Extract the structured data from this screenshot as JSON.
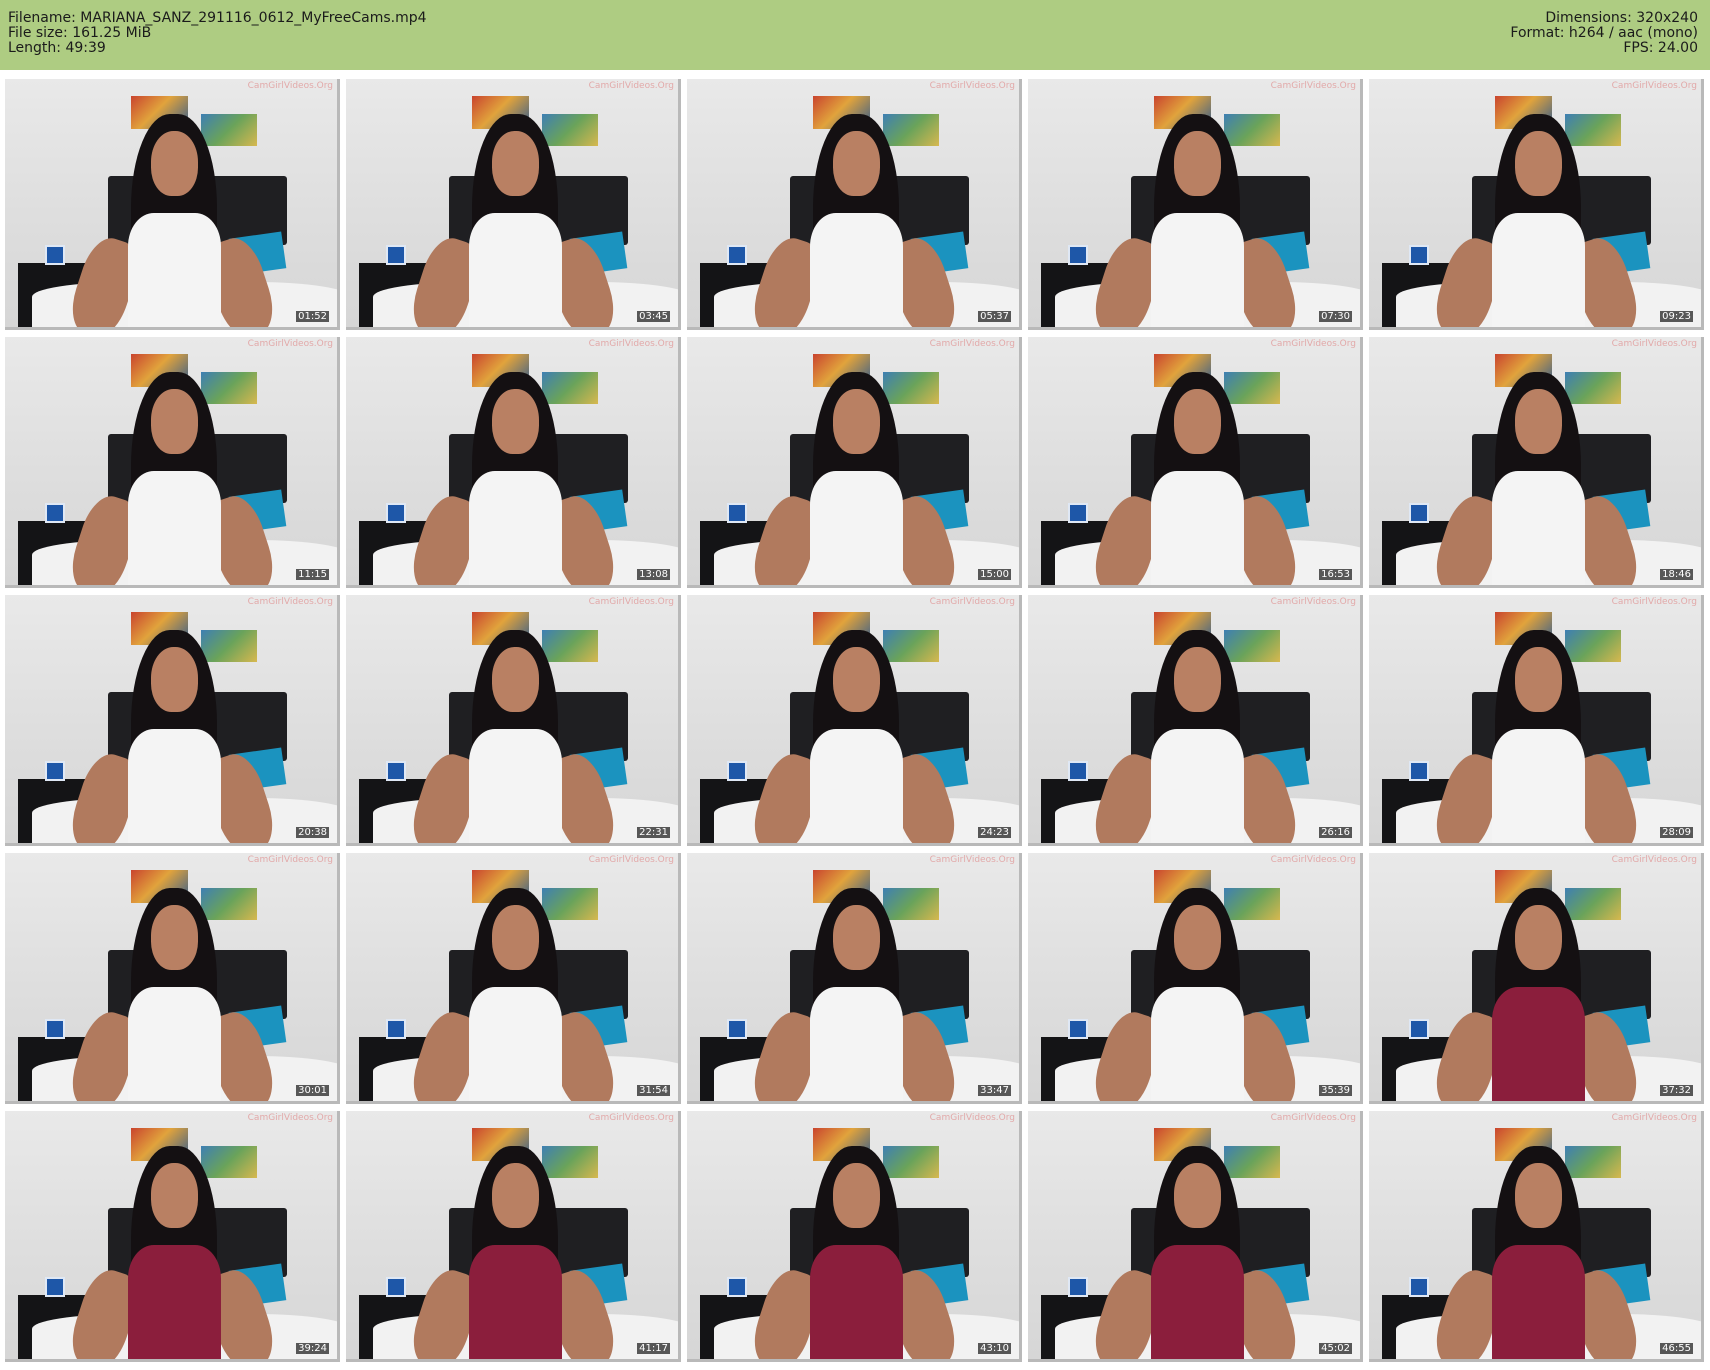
{
  "header": {
    "left": [
      "Filename: MARIANA_SANZ_291116_0612_MyFreeCams.mp4",
      "File size: 161.25 MiB",
      "Length: 49:39"
    ],
    "right": [
      "Dimensions: 320x240",
      "Format: h264 / aac (mono)",
      "FPS: 24.00"
    ]
  },
  "watermark": "CamGirlVideos.Org",
  "colors": {
    "header_bg": "#aecc82",
    "bra": "#8b1e3c",
    "pillow": "#1b93bf"
  },
  "thumbnails": [
    {
      "time": "01:52",
      "top": "white"
    },
    {
      "time": "03:45",
      "top": "white"
    },
    {
      "time": "05:37",
      "top": "white"
    },
    {
      "time": "07:30",
      "top": "white"
    },
    {
      "time": "09:23",
      "top": "white"
    },
    {
      "time": "11:15",
      "top": "white"
    },
    {
      "time": "13:08",
      "top": "white"
    },
    {
      "time": "15:00",
      "top": "white"
    },
    {
      "time": "16:53",
      "top": "white"
    },
    {
      "time": "18:46",
      "top": "white"
    },
    {
      "time": "20:38",
      "top": "white"
    },
    {
      "time": "22:31",
      "top": "white"
    },
    {
      "time": "24:23",
      "top": "white"
    },
    {
      "time": "26:16",
      "top": "white"
    },
    {
      "time": "28:09",
      "top": "white"
    },
    {
      "time": "30:01",
      "top": "white"
    },
    {
      "time": "31:54",
      "top": "white"
    },
    {
      "time": "33:47",
      "top": "white"
    },
    {
      "time": "35:39",
      "top": "white"
    },
    {
      "time": "37:32",
      "top": "bra"
    },
    {
      "time": "39:24",
      "top": "bra"
    },
    {
      "time": "41:17",
      "top": "bra"
    },
    {
      "time": "43:10",
      "top": "bra"
    },
    {
      "time": "45:02",
      "top": "bra"
    },
    {
      "time": "46:55",
      "top": "bra"
    }
  ]
}
